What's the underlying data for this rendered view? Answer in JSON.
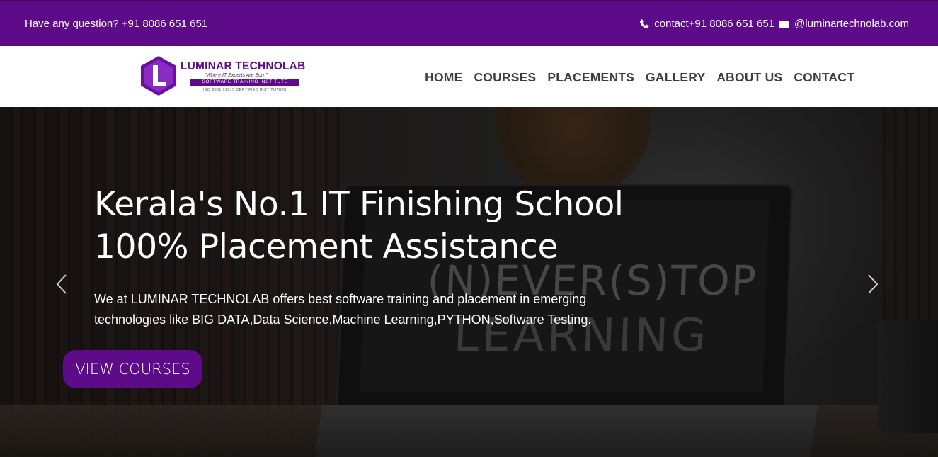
{
  "topbar": {
    "question": "Have any question? +91 8086 651 651",
    "contact": "contact+91 8086 651 651",
    "email": "@luminartechnolab.com",
    "phone_icon": "phone-icon",
    "mail_icon": "envelope-icon"
  },
  "logo": {
    "brand": "LUMINAR TECHNOLAB",
    "tagline": "\"Where IT Experts Are Born\"",
    "strip": "SOFTWARE TRAINING INSTITUTE",
    "cert": "ISO 9001 | 2015 CERTIFIED INSTITUTION",
    "mark_letter": "L"
  },
  "nav": {
    "items": [
      {
        "label": "HOME"
      },
      {
        "label": "COURSES"
      },
      {
        "label": "PLACEMENTS"
      },
      {
        "label": "GALLERY"
      },
      {
        "label": "ABOUT US"
      },
      {
        "label": "CONTACT"
      }
    ]
  },
  "hero": {
    "title_line1": "Kerala's No.1 IT Finishing School",
    "title_line2": "100% Placement Assistance",
    "description": "We at LUMINAR TECHNOLAB offers best software training and placement in emerging technologies like BIG DATA,Data Science,Machine Learning,PYTHON,Software Testing.",
    "cta_label": "VIEW COURSES",
    "chalk_line1": "(N)EVER(S)TOP",
    "chalk_line2": "LEARNING",
    "prev_icon": "chevron-left-icon",
    "next_icon": "chevron-right-icon"
  },
  "colors": {
    "brand_purple": "#5e0b8a",
    "nav_text": "#3d3d3d",
    "white": "#ffffff"
  }
}
